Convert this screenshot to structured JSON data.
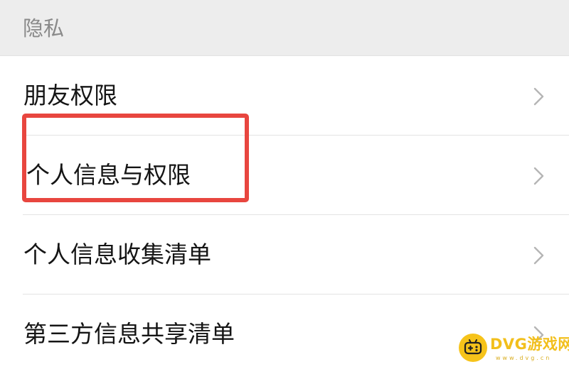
{
  "section": {
    "title": "隐私"
  },
  "items": [
    {
      "label": "朋友权限",
      "icon": "chevron-right-icon"
    },
    {
      "label": "个人信息与权限",
      "icon": "chevron-right-icon"
    },
    {
      "label": "个人信息收集清单",
      "icon": "chevron-right-icon"
    },
    {
      "label": "第三方信息共享清单",
      "icon": "chevron-right-icon"
    }
  ],
  "annotation": {
    "highlight_color": "#e8463f"
  },
  "watermark": {
    "text": "DVG游戏网",
    "subtext": "www.dvg.cn",
    "icon": "gamepad-icon",
    "color": "#f2bf1c"
  },
  "colors": {
    "header_bg": "#ededed",
    "label_text": "#151515",
    "chevron": "#b5b5b5"
  }
}
